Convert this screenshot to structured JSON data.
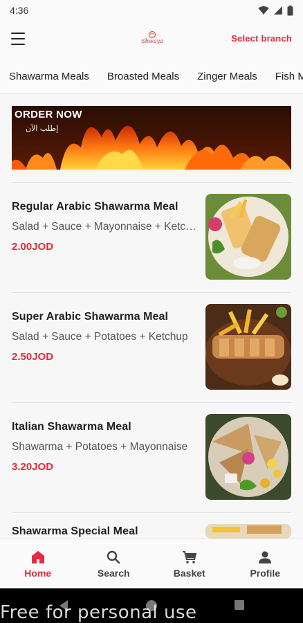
{
  "status_bar": {
    "time": "4:36"
  },
  "header": {
    "select_branch": "Select branch",
    "logo_text": "Shwaya"
  },
  "tabs": [
    {
      "label": "Shawarma Meals",
      "active": true
    },
    {
      "label": "Broasted Meals",
      "active": false
    },
    {
      "label": "Zinger Meals",
      "active": false
    },
    {
      "label": "Fish Meals",
      "active": false
    }
  ],
  "banner": {
    "title": "ORDER NOW",
    "subtitle": "إطلب الآن"
  },
  "meals": [
    {
      "name": "Regular Arabic Shawarma Meal",
      "description": "Salad + Sauce + Mayonnaise + Ketchup",
      "price": "2.00JOD"
    },
    {
      "name": "Super Arabic Shawarma Meal",
      "description": "Salad + Sauce + Potatoes + Ketchup",
      "price": "2.50JOD"
    },
    {
      "name": "Italian Shawarma Meal",
      "description": "Shawarma + Potatoes + Mayonnaise",
      "price": "3.20JOD"
    },
    {
      "name": "Shawarma Special Meal",
      "description": "",
      "price": ""
    }
  ],
  "bottom_nav": [
    {
      "label": "Home",
      "icon": "home-icon",
      "active": true
    },
    {
      "label": "Search",
      "icon": "search-icon",
      "active": false
    },
    {
      "label": "Basket",
      "icon": "cart-icon",
      "active": false
    },
    {
      "label": "Profile",
      "icon": "profile-icon",
      "active": false
    }
  ],
  "watermark": "Free for personal use",
  "colors": {
    "accent": "#e8293d",
    "background": "#f7f7f7"
  }
}
